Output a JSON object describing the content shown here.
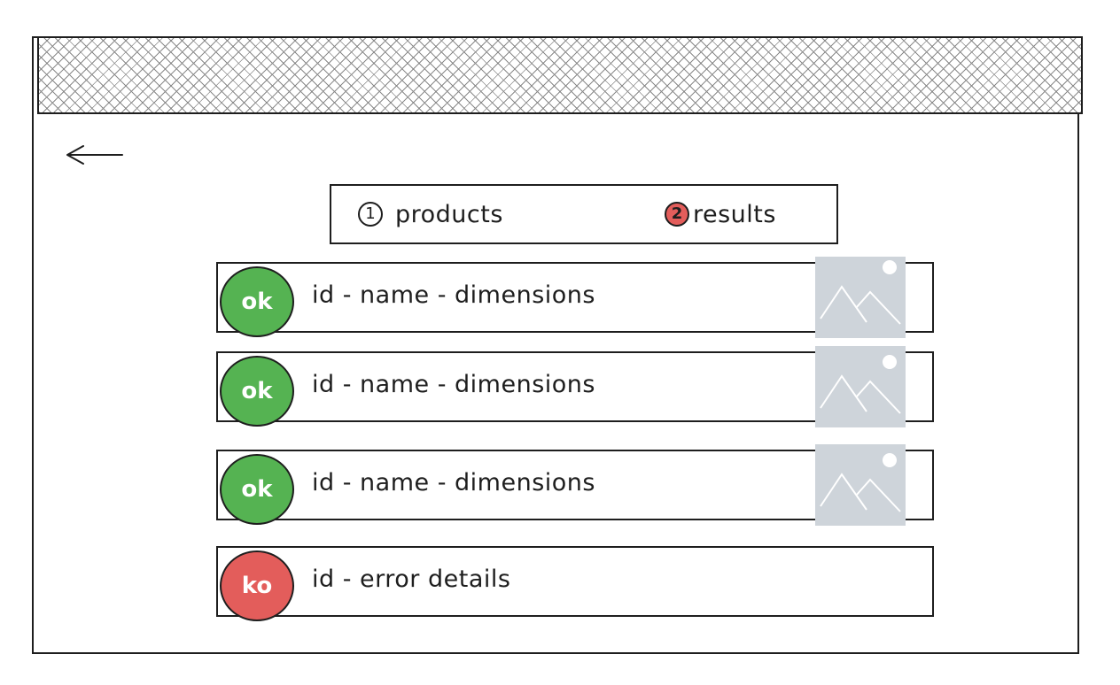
{
  "steps": [
    {
      "number": "1",
      "label": "products",
      "active": false
    },
    {
      "number": "2",
      "label": "results",
      "active": true
    }
  ],
  "results": [
    {
      "status": "ok",
      "text": "id - name - dimensions",
      "has_image": true,
      "status_color": "#55b352"
    },
    {
      "status": "ok",
      "text": "id - name - dimensions",
      "has_image": true,
      "status_color": "#55b352"
    },
    {
      "status": "ok",
      "text": "id - name - dimensions",
      "has_image": true,
      "status_color": "#55b352"
    },
    {
      "status": "ko",
      "text": "id - error details",
      "has_image": false,
      "status_color": "#e35d5b"
    }
  ],
  "icons": {
    "back": "arrow-left-icon",
    "thumbnail": "image-placeholder-icon"
  },
  "colors": {
    "ok": "#55b352",
    "ko": "#e35d5b",
    "placeholder": "#ced4da"
  }
}
